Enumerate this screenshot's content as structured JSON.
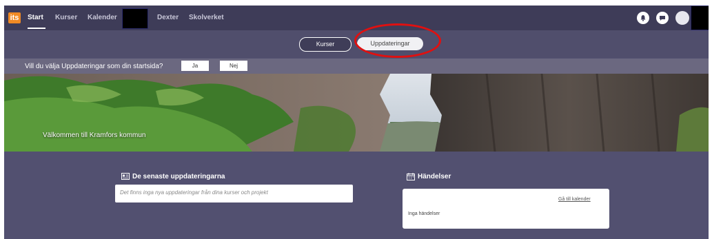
{
  "nav": {
    "logo": "its",
    "items": [
      {
        "label": "Start",
        "active": true
      },
      {
        "label": "Kurser"
      },
      {
        "label": "Kalender"
      },
      {
        "label": "Dexter"
      },
      {
        "label": "Skolverket"
      }
    ],
    "icons": [
      "bell-icon",
      "chat-icon",
      "avatar"
    ]
  },
  "toggle": {
    "courses_label": "Kurser",
    "updates_label": "Uppdateringar"
  },
  "startpage_prompt": {
    "question": "Vill du välja Uppdateringar som din startsida?",
    "yes_label": "Ja",
    "no_label": "Nej"
  },
  "hero": {
    "welcome": "Välkommen till Kramfors kommun"
  },
  "updates": {
    "title": "De senaste uppdateringarna",
    "empty_text": "Det finns inga nya uppdateringar från dina kurser och projekt"
  },
  "events": {
    "title": "Händelser",
    "calendar_link": "Gå till kalender",
    "empty_text": "Inga händelser"
  },
  "colors": {
    "nav_bg": "#3e3c58",
    "page_bg": "#525070",
    "logo": "#f08a24",
    "highlight": "#e01010"
  }
}
